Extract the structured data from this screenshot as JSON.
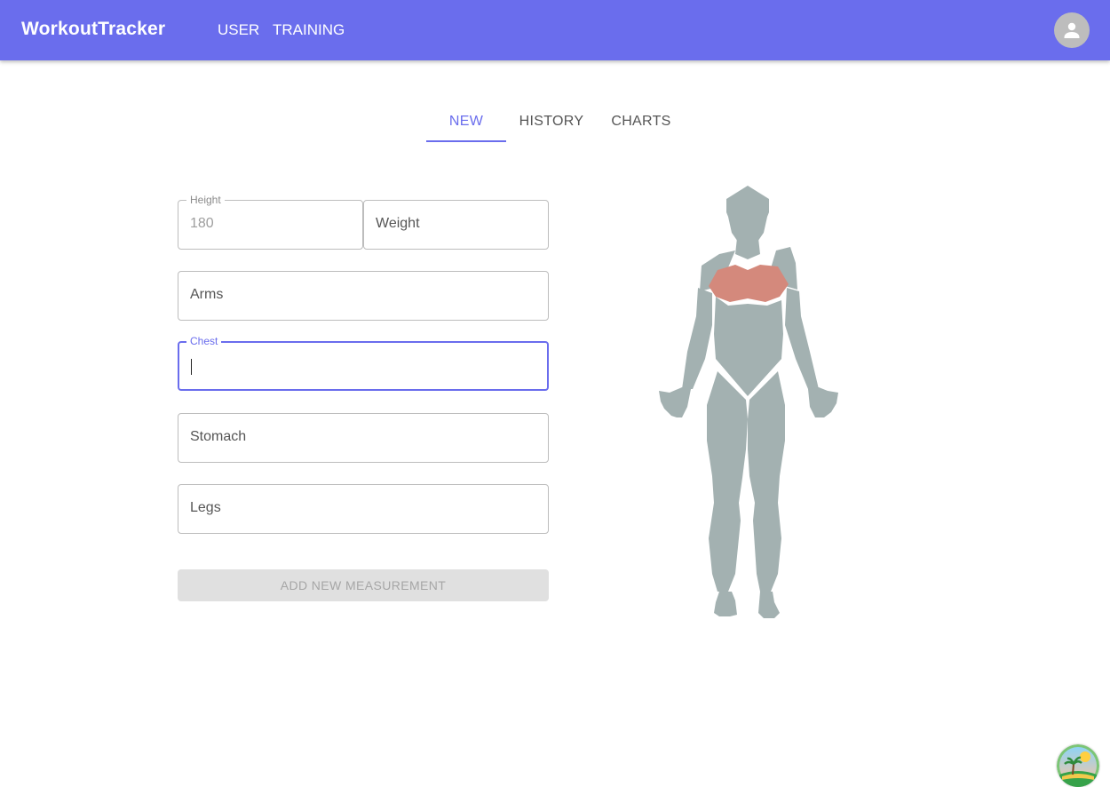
{
  "app": {
    "brand": "WorkoutTracker",
    "nav": [
      {
        "label": "USER"
      },
      {
        "label": "TRAINING"
      }
    ],
    "avatar_icon": "user-avatar-icon",
    "accent_color": "#6a6ded"
  },
  "tabs": {
    "items": [
      {
        "label": "NEW",
        "active": true
      },
      {
        "label": "HISTORY",
        "active": false
      },
      {
        "label": "CHARTS",
        "active": false
      }
    ]
  },
  "form": {
    "height": {
      "label": "Height",
      "value": "180"
    },
    "weight": {
      "placeholder": "Weight"
    },
    "arms": {
      "placeholder": "Arms"
    },
    "chest": {
      "label": "Chest",
      "value": "",
      "focused": true
    },
    "stomach": {
      "placeholder": "Stomach"
    },
    "legs": {
      "placeholder": "Legs"
    },
    "submit_label": "ADD NEW MEASUREMENT",
    "submit_disabled": true
  },
  "body_map": {
    "highlighted_region": "chest",
    "highlight_color": "#d4897c",
    "base_color": "#a3b1b1"
  },
  "corner_badge_icon": "island-icon"
}
